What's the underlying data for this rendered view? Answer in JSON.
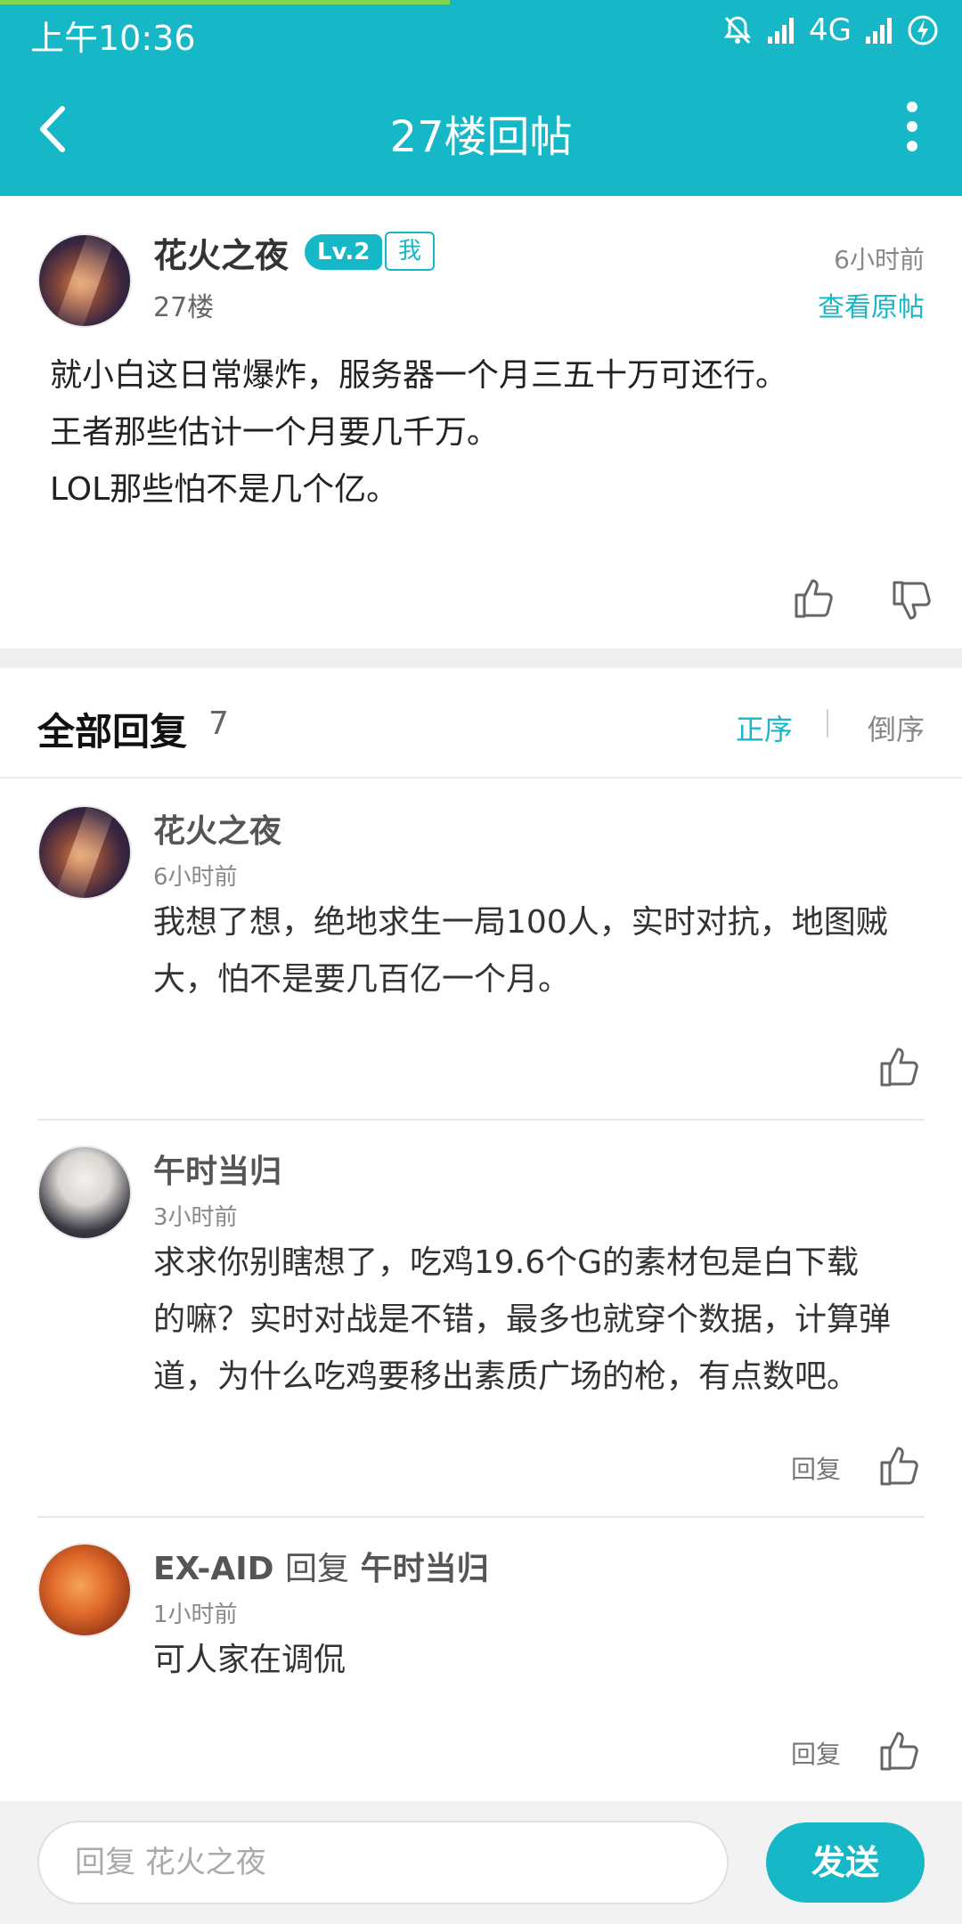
{
  "status_bar": {
    "time": "上午10:36",
    "network": "4G"
  },
  "nav": {
    "title": "27楼回帖"
  },
  "post": {
    "author": "花火之夜",
    "level": "Lv.2",
    "me_badge": "我",
    "floor": "27楼",
    "time": "6小时前",
    "view_original": "查看原帖",
    "lines": [
      "就小白这日常爆炸，服务器一个月三五十万可还行。",
      "王者那些估计一个月要几千万。",
      "LOL那些怕不是几个亿。"
    ]
  },
  "replies_header": {
    "title": "全部回复",
    "count": "7",
    "sort_asc": "正序",
    "sort_desc": "倒序"
  },
  "replies": [
    {
      "author": "花火之夜",
      "time": "6小时前",
      "lines": [
        "我想了想，绝地求生一局100人，实时对抗，地图贼",
        "大，怕不是要几百亿一个月。"
      ]
    },
    {
      "author": "午时当归",
      "time": "3小时前",
      "lines": [
        "求求你别瞎想了，吃鸡19.6个G的素材包是白下载",
        "的嘛？实时对战是不错，最多也就穿个数据，计算弹",
        "道，为什么吃鸡要移出素质广场的枪，有点数吧。"
      ],
      "reply_label": "回复"
    },
    {
      "author": "EX-AID",
      "reply_verb": "回复",
      "reply_to": "午时当归",
      "time": "1小时前",
      "lines": [
        "可人家在调侃"
      ],
      "reply_label": "回复"
    }
  ],
  "bottom": {
    "placeholder": "回复 花火之夜",
    "send_label": "发送"
  },
  "colors": {
    "accent": "#16b8c8",
    "progress": "#7fd64f"
  }
}
